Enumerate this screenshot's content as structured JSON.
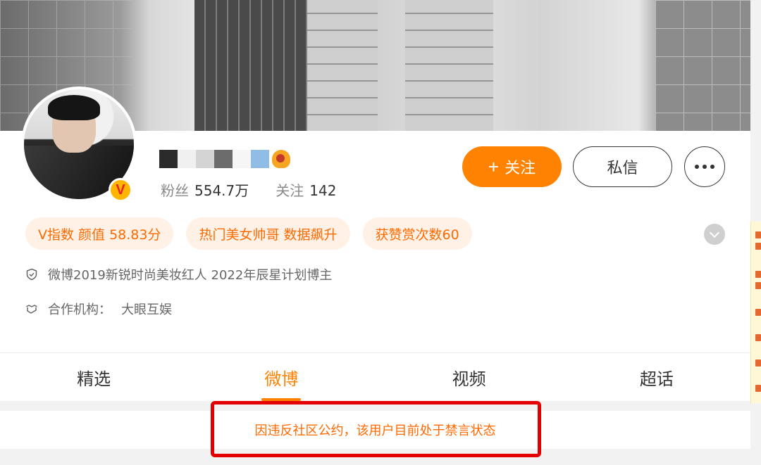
{
  "profile": {
    "followers_label": "粉丝",
    "followers_count": "554.7万",
    "following_label": "关注",
    "following_count": "142",
    "verified_badge": "V"
  },
  "actions": {
    "follow_plus": "+",
    "follow_label": "关注",
    "message_label": "私信"
  },
  "tags": [
    "V指数 颜值 58.83分",
    "热门美女帅哥 数据飙升",
    "获赞赏次数60"
  ],
  "info": {
    "honor": "微博2019新锐时尚美妆红人 2022年辰星计划博主",
    "agency_label": "合作机构：",
    "agency_value": "大眼互娱"
  },
  "tabs": [
    {
      "label": "精选",
      "active": false
    },
    {
      "label": "微博",
      "active": true
    },
    {
      "label": "视频",
      "active": false
    },
    {
      "label": "超话",
      "active": false
    }
  ],
  "notice": "因违反社区公约，该用户目前处于禁言状态",
  "colors": {
    "accent": "#ff8200",
    "tag_bg": "#fff1e6",
    "tag_text": "#ff6a00",
    "highlight_box": "#e30000"
  },
  "icons": [
    "shield-icon",
    "handshake-icon",
    "more-icon",
    "expand-chevron-icon",
    "vip-crown-icon"
  ]
}
